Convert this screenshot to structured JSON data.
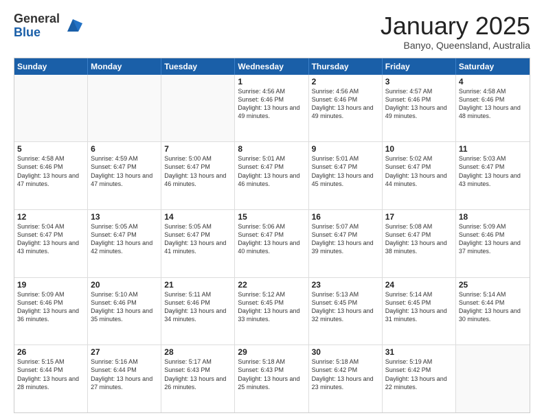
{
  "header": {
    "logo_general": "General",
    "logo_blue": "Blue",
    "month_year": "January 2025",
    "location": "Banyo, Queensland, Australia"
  },
  "days_of_week": [
    "Sunday",
    "Monday",
    "Tuesday",
    "Wednesday",
    "Thursday",
    "Friday",
    "Saturday"
  ],
  "weeks": [
    [
      {
        "day": "",
        "info": ""
      },
      {
        "day": "",
        "info": ""
      },
      {
        "day": "",
        "info": ""
      },
      {
        "day": "1",
        "info": "Sunrise: 4:56 AM\nSunset: 6:46 PM\nDaylight: 13 hours\nand 49 minutes."
      },
      {
        "day": "2",
        "info": "Sunrise: 4:56 AM\nSunset: 6:46 PM\nDaylight: 13 hours\nand 49 minutes."
      },
      {
        "day": "3",
        "info": "Sunrise: 4:57 AM\nSunset: 6:46 PM\nDaylight: 13 hours\nand 49 minutes."
      },
      {
        "day": "4",
        "info": "Sunrise: 4:58 AM\nSunset: 6:46 PM\nDaylight: 13 hours\nand 48 minutes."
      }
    ],
    [
      {
        "day": "5",
        "info": "Sunrise: 4:58 AM\nSunset: 6:46 PM\nDaylight: 13 hours\nand 47 minutes."
      },
      {
        "day": "6",
        "info": "Sunrise: 4:59 AM\nSunset: 6:47 PM\nDaylight: 13 hours\nand 47 minutes."
      },
      {
        "day": "7",
        "info": "Sunrise: 5:00 AM\nSunset: 6:47 PM\nDaylight: 13 hours\nand 46 minutes."
      },
      {
        "day": "8",
        "info": "Sunrise: 5:01 AM\nSunset: 6:47 PM\nDaylight: 13 hours\nand 46 minutes."
      },
      {
        "day": "9",
        "info": "Sunrise: 5:01 AM\nSunset: 6:47 PM\nDaylight: 13 hours\nand 45 minutes."
      },
      {
        "day": "10",
        "info": "Sunrise: 5:02 AM\nSunset: 6:47 PM\nDaylight: 13 hours\nand 44 minutes."
      },
      {
        "day": "11",
        "info": "Sunrise: 5:03 AM\nSunset: 6:47 PM\nDaylight: 13 hours\nand 43 minutes."
      }
    ],
    [
      {
        "day": "12",
        "info": "Sunrise: 5:04 AM\nSunset: 6:47 PM\nDaylight: 13 hours\nand 43 minutes."
      },
      {
        "day": "13",
        "info": "Sunrise: 5:05 AM\nSunset: 6:47 PM\nDaylight: 13 hours\nand 42 minutes."
      },
      {
        "day": "14",
        "info": "Sunrise: 5:05 AM\nSunset: 6:47 PM\nDaylight: 13 hours\nand 41 minutes."
      },
      {
        "day": "15",
        "info": "Sunrise: 5:06 AM\nSunset: 6:47 PM\nDaylight: 13 hours\nand 40 minutes."
      },
      {
        "day": "16",
        "info": "Sunrise: 5:07 AM\nSunset: 6:47 PM\nDaylight: 13 hours\nand 39 minutes."
      },
      {
        "day": "17",
        "info": "Sunrise: 5:08 AM\nSunset: 6:47 PM\nDaylight: 13 hours\nand 38 minutes."
      },
      {
        "day": "18",
        "info": "Sunrise: 5:09 AM\nSunset: 6:46 PM\nDaylight: 13 hours\nand 37 minutes."
      }
    ],
    [
      {
        "day": "19",
        "info": "Sunrise: 5:09 AM\nSunset: 6:46 PM\nDaylight: 13 hours\nand 36 minutes."
      },
      {
        "day": "20",
        "info": "Sunrise: 5:10 AM\nSunset: 6:46 PM\nDaylight: 13 hours\nand 35 minutes."
      },
      {
        "day": "21",
        "info": "Sunrise: 5:11 AM\nSunset: 6:46 PM\nDaylight: 13 hours\nand 34 minutes."
      },
      {
        "day": "22",
        "info": "Sunrise: 5:12 AM\nSunset: 6:45 PM\nDaylight: 13 hours\nand 33 minutes."
      },
      {
        "day": "23",
        "info": "Sunrise: 5:13 AM\nSunset: 6:45 PM\nDaylight: 13 hours\nand 32 minutes."
      },
      {
        "day": "24",
        "info": "Sunrise: 5:14 AM\nSunset: 6:45 PM\nDaylight: 13 hours\nand 31 minutes."
      },
      {
        "day": "25",
        "info": "Sunrise: 5:14 AM\nSunset: 6:44 PM\nDaylight: 13 hours\nand 30 minutes."
      }
    ],
    [
      {
        "day": "26",
        "info": "Sunrise: 5:15 AM\nSunset: 6:44 PM\nDaylight: 13 hours\nand 28 minutes."
      },
      {
        "day": "27",
        "info": "Sunrise: 5:16 AM\nSunset: 6:44 PM\nDaylight: 13 hours\nand 27 minutes."
      },
      {
        "day": "28",
        "info": "Sunrise: 5:17 AM\nSunset: 6:43 PM\nDaylight: 13 hours\nand 26 minutes."
      },
      {
        "day": "29",
        "info": "Sunrise: 5:18 AM\nSunset: 6:43 PM\nDaylight: 13 hours\nand 25 minutes."
      },
      {
        "day": "30",
        "info": "Sunrise: 5:18 AM\nSunset: 6:42 PM\nDaylight: 13 hours\nand 23 minutes."
      },
      {
        "day": "31",
        "info": "Sunrise: 5:19 AM\nSunset: 6:42 PM\nDaylight: 13 hours\nand 22 minutes."
      },
      {
        "day": "",
        "info": ""
      }
    ]
  ],
  "colors": {
    "header_bg": "#1a5fa8",
    "header_text": "#ffffff",
    "empty_bg": "#f9f9f9",
    "gray_bg": "#f0f0f0"
  }
}
